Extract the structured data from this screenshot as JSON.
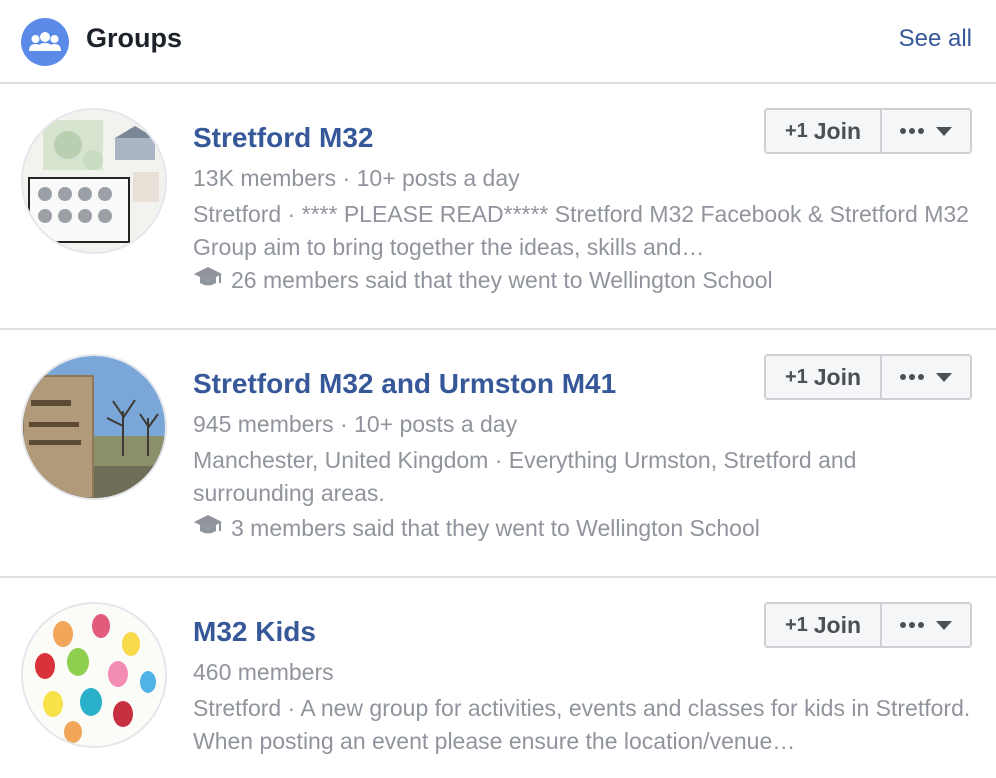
{
  "header": {
    "title": "Groups",
    "see_all": "See all",
    "icon": "groups-icon"
  },
  "groups": [
    {
      "name": "Stretford M32",
      "stats": "13K members · 10+ posts a day",
      "description": "Stretford · **** PLEASE READ***** Stretford M32 Facebook & Stretford M32 Group aim to bring together the ideas, skills and…",
      "mutual": "26 members said that they went to Wellington School",
      "join_label": "Join"
    },
    {
      "name": "Stretford M32 and Urmston M41",
      "stats": "945 members · 10+ posts a day",
      "description": "Manchester, United Kingdom · Everything Urmston, Stretford and surrounding areas.",
      "mutual": "3 members said that they went to Wellington School",
      "join_label": "Join"
    },
    {
      "name": "M32 Kids",
      "stats": "460 members",
      "description": "Stretford · A new group for activities, events and classes for kids in Stretford. When posting an event please ensure the location/venue…",
      "join_label": "Join"
    }
  ],
  "colors": {
    "link": "#365899",
    "secondary_text": "#90949c",
    "divider": "#dddfe2",
    "header_icon_bg": "#5b8ae8"
  }
}
